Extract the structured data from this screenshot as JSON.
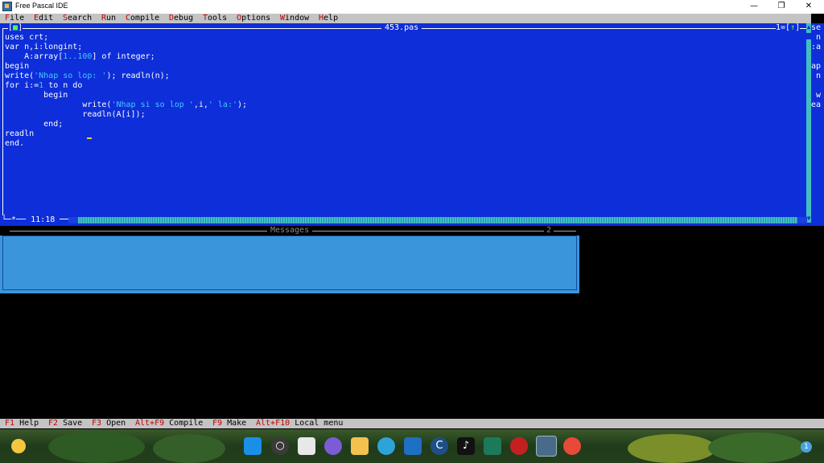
{
  "window": {
    "title": "Free Pascal IDE",
    "minimize_glyph": "—",
    "restore_glyph": "❐",
    "close_glyph": "✕"
  },
  "menu": [
    {
      "hot": "F",
      "rest": "ile"
    },
    {
      "hot": "E",
      "rest": "dit"
    },
    {
      "hot": "S",
      "rest": "earch"
    },
    {
      "hot": "R",
      "rest": "un"
    },
    {
      "hot": "C",
      "rest": "ompile"
    },
    {
      "hot": "D",
      "rest": "ebug"
    },
    {
      "hot": "T",
      "rest": "ools"
    },
    {
      "hot": "O",
      "rest": "ptions"
    },
    {
      "hot": "W",
      "rest": "indow"
    },
    {
      "hot": "H",
      "rest": "elp"
    }
  ],
  "editor": {
    "filename": "453.pas",
    "close_box": "■",
    "window_number": "1",
    "zoom_box": "↑",
    "cursor_position": "11:18",
    "modified_marker": "*",
    "code": {
      "l1": "uses crt;",
      "l2": "var n,i:longint;",
      "l3a": "    A:array[",
      "l3b": "1",
      "l3c": "..",
      "l3d": "100",
      "l3e": "] of integer;",
      "l4": "begin",
      "l5a": "write(",
      "l5b": "'Nhap so lop: '",
      "l5c": "); readln(n);",
      "l6a": "for i:=",
      "l6b": "1",
      "l6c": " to n do",
      "l7": "        begin",
      "l8a": "                write(",
      "l8b": "'Nhap si so lop '",
      "l8c": ",i,",
      "l8d": "' la:'",
      "l8e": ");",
      "l9": "                readln(A[i]);",
      "l10": "        end;",
      "l11": "readln",
      "l12": "end."
    }
  },
  "background_window_strip": [
    "se",
    " n",
    ":a",
    "",
    "ap",
    " n",
    "",
    " w",
    "ea"
  ],
  "messages": {
    "title": "Messages",
    "window_number": "2"
  },
  "status_bar": [
    {
      "key": "F1",
      "label": "Help"
    },
    {
      "key": "F2",
      "label": "Save"
    },
    {
      "key": "F3",
      "label": "Open"
    },
    {
      "key": "Alt+F9",
      "label": "Compile"
    },
    {
      "key": "F9",
      "label": "Make"
    },
    {
      "key": "Alt+F10",
      "label": "Local menu"
    }
  ],
  "taskbar": {
    "icons": [
      "windows-start-icon",
      "search-icon",
      "task-view-icon",
      "chat-icon",
      "file-explorer-icon",
      "edge-icon",
      "store-icon",
      "app-c-icon",
      "tiktok-icon",
      "app-download-icon",
      "app-red-icon",
      "free-pascal-icon",
      "chrome-icon"
    ],
    "notification_count": "1"
  }
}
